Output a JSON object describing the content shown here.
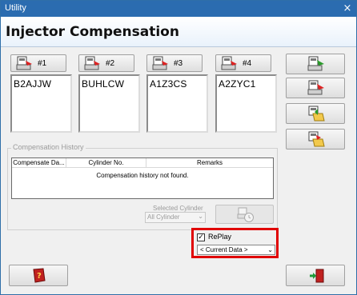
{
  "window": {
    "title": "Utility",
    "close_glyph": "×"
  },
  "header": {
    "title": "Injector Compensation"
  },
  "injectors": [
    {
      "button_label": "#1",
      "code": "B2AJJW",
      "icon": "injector-write-icon"
    },
    {
      "button_label": "#2",
      "code": "BUHLCW",
      "icon": "injector-write-icon"
    },
    {
      "button_label": "#3",
      "code": "A1Z3CS",
      "icon": "injector-write-icon"
    },
    {
      "button_label": "#4",
      "code": "A2ZYC1",
      "icon": "injector-write-icon"
    }
  ],
  "side_buttons": [
    {
      "icon": "write-all-icon"
    },
    {
      "icon": "read-all-icon"
    },
    {
      "icon": "open-folder-icon"
    },
    {
      "icon": "save-folder-icon"
    }
  ],
  "history": {
    "group_label": "Compensation History",
    "columns": [
      "Compensate Da...",
      "Cylinder No.",
      "Remarks"
    ],
    "empty_message": "Compensation history not found.",
    "selected_cylinder_label": "Selected Cylinder",
    "selected_cylinder_value": "All Cylinder",
    "replay_icon": "replay-clock-icon"
  },
  "replay": {
    "checked": true,
    "check_glyph": "✓",
    "label": "RePlay",
    "dropdown_value": "< Current Data >",
    "highlight_color": "#e00000"
  },
  "footer": {
    "help_icon": "help-book-icon",
    "exit_icon": "exit-door-icon"
  },
  "colors": {
    "titlebar": "#2b6cb0",
    "header_bg": "#e9f2fb"
  },
  "dropdown_arrow": "⌄"
}
